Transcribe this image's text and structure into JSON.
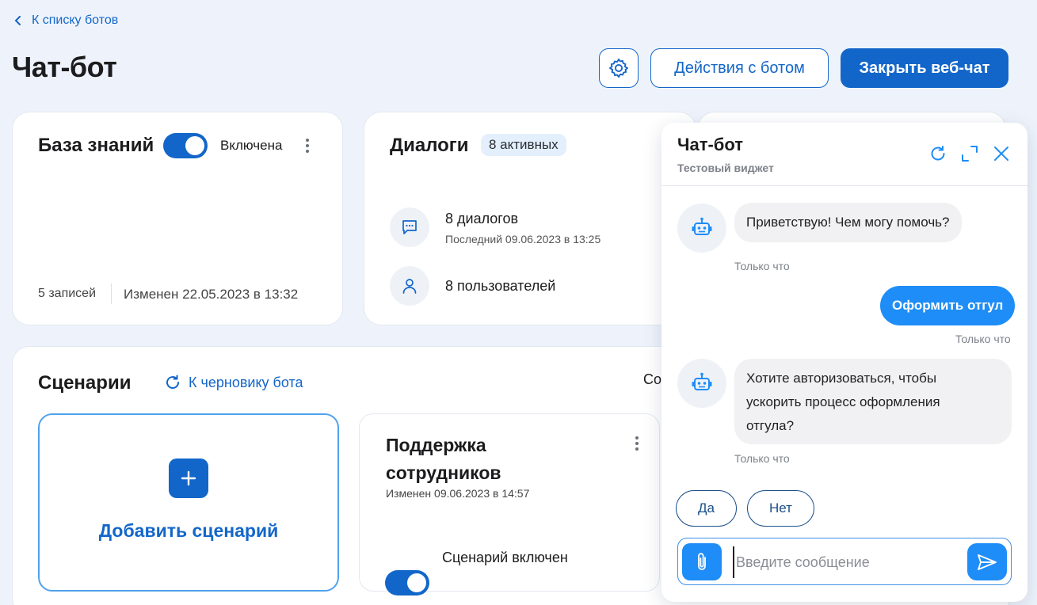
{
  "nav": {
    "back_label": "К списку ботов"
  },
  "header": {
    "title": "Чат-бот",
    "actions_label": "Действия с ботом",
    "close_chat_label": "Закрыть веб-чат"
  },
  "knowledge": {
    "title": "База знаний",
    "toggle_state": "Включена",
    "records": "5 записей",
    "modified": "Изменен 22.05.2023 в 13:32"
  },
  "dialogs": {
    "title": "Диалоги",
    "badge": "8 активных",
    "count": "8 диалогов",
    "last": "Последний 09.06.2023 в 13:25",
    "users": "8 пользователей"
  },
  "scenarios": {
    "title": "Сценарии",
    "draft_link": "К черновику бота",
    "partial_text": "Со",
    "add_label": "Добавить сценарий",
    "items": [
      {
        "title_line1": "Поддержка",
        "title_line2": "сотрудников",
        "modified": "Изменен 09.06.2023 в 14:57",
        "toggle_label": "Сценарий включен"
      }
    ]
  },
  "chat": {
    "title": "Чат-бот",
    "subtitle": "Тестовый виджет",
    "messages": [
      {
        "from": "bot",
        "text": "Приветствую! Чем могу помочь?",
        "time": "Только что"
      },
      {
        "from": "user",
        "text": "Оформить отгул",
        "time": "Только что"
      },
      {
        "from": "bot",
        "lines": [
          "Хотите авторизоваться, чтобы",
          "ускорить процесс оформления",
          "отгула?"
        ],
        "time": "Только что"
      }
    ],
    "quick_replies": [
      "Да",
      "Нет"
    ],
    "input_placeholder": "Введите сообщение"
  },
  "colors": {
    "primary": "#1366c9",
    "chat_accent": "#1e8df7",
    "background": "#eef3fb"
  }
}
